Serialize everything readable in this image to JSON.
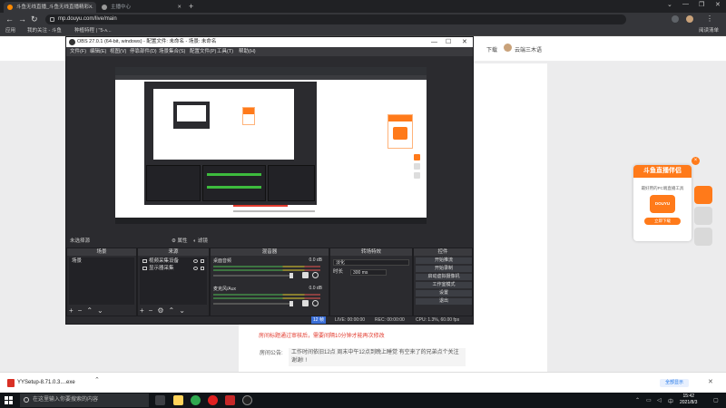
{
  "browser": {
    "tabs": [
      {
        "label": "斗鱼无线直播_斗鱼无线直播精彩..."
      },
      {
        "label": "主播中心"
      }
    ],
    "url": "mp.douyu.com/live/main",
    "bookmarks": [
      "应用",
      "我的关注 - 斗鱼",
      "种植特程 | \"5-ᴀ..."
    ],
    "reading_list": "阅读清单"
  },
  "page": {
    "download_label": "下载",
    "user_name": "云端三木语",
    "notice_red": "房间标题通过审核后，需要间隔10分钟才能再次修改",
    "announce_label": "房间公告:",
    "announce_text": "工作时间依旧12点 周末中午12点到晚上睡觉 有空来了的兄弟点个关注 谢谢! !",
    "promo": {
      "title": "斗鱼直播伴侣",
      "sub": "最好用的PC端直播工具",
      "logo": "DOUYU",
      "button": "立即下载"
    }
  },
  "obs": {
    "title": "OBS 27.0.1 (64-bit, windows) - 配置文件: 未命名 - 场景: 未命名",
    "menu": [
      "文件(F)",
      "编辑(E)",
      "视图(V)",
      "停靠部件(D)",
      "场景集合(S)",
      "配置文件(P)",
      "工具(T)",
      "帮助(H)"
    ],
    "status_strip": {
      "left": "未选择源",
      "props": "属性",
      "filters": "滤镜"
    },
    "docks": {
      "scenes": {
        "title": "场景",
        "items": [
          "场景"
        ]
      },
      "sources": {
        "title": "来源",
        "items": [
          "视频采集设备",
          "显示器采集"
        ]
      },
      "mixer": {
        "title": "混音器",
        "channels": [
          {
            "name": "桌面音频",
            "db": "0.0 dB"
          },
          {
            "name": "麦克风/Aux",
            "db": "0.0 dB"
          }
        ]
      },
      "transitions": {
        "title": "转场特效",
        "type": "淡化",
        "duration_label": "时长",
        "duration": "300 ms"
      },
      "controls": {
        "title": "控件",
        "buttons": [
          "开始推流",
          "开始录制",
          "启动虚拟摄像机",
          "工作室模式",
          "设置",
          "退出"
        ]
      }
    },
    "statusbar": {
      "live": "LIVE: 00:00:00",
      "rec": "REC: 00:00:00",
      "cpu": "CPU: 1.3%, 60.00 fps",
      "dropped_badge": "12 帧"
    }
  },
  "download_shelf": {
    "file": "YYSetup-8.71.0.3....exe",
    "show_all": "全部显示"
  },
  "taskbar": {
    "search_placeholder": "在这里输入你要搜索的内容",
    "time": "15:42",
    "date": "2021/8/3"
  },
  "colors": {
    "accent_orange": "#ff7a1a",
    "notice_red": "#e23b2e",
    "obs_bg": "#2b2b2f"
  }
}
